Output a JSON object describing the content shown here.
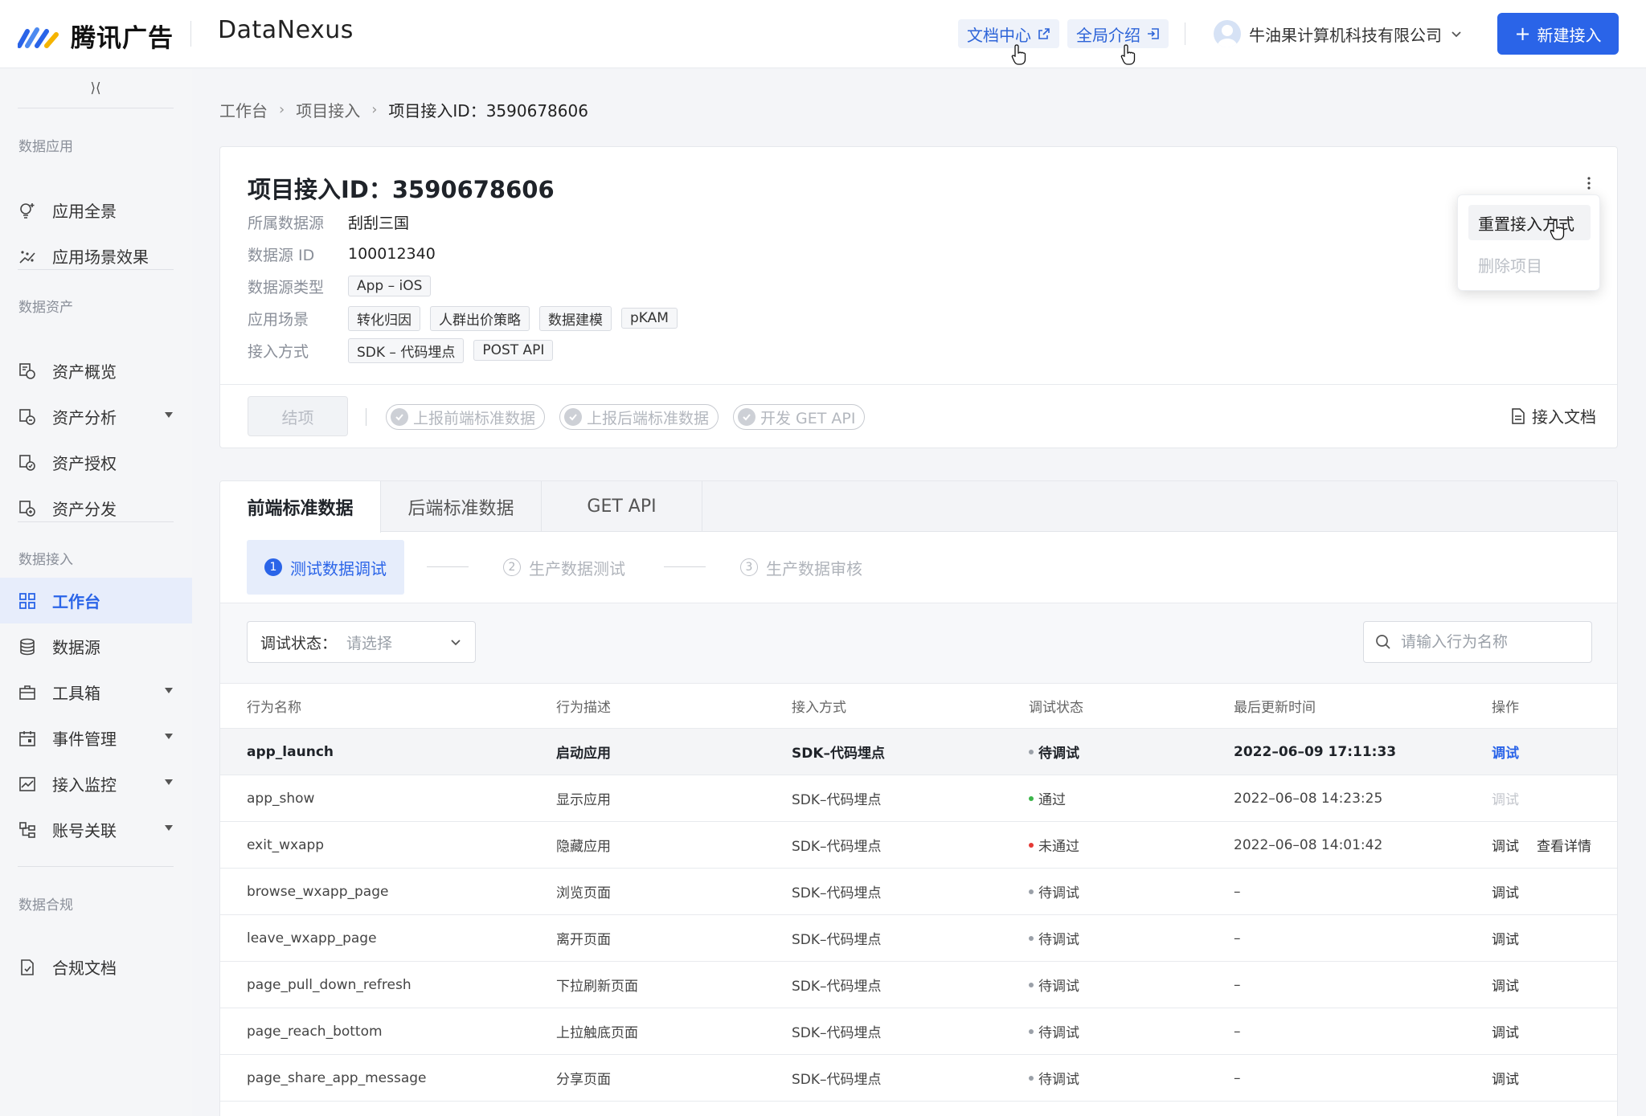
{
  "header": {
    "logo_text": "腾讯广告",
    "product": "DataNexus",
    "doc_center": "文档中心",
    "global_intro": "全局介绍",
    "account": "牛油果计算机科技有限公司",
    "new_button": "新建接入"
  },
  "sidebar": {
    "groups": [
      "数据应用",
      "数据资产",
      "数据接入",
      "数据合规"
    ],
    "items": [
      {
        "label": "应用全景",
        "icon": "bulb-icon"
      },
      {
        "label": "应用场景效果",
        "icon": "scatter-icon"
      },
      {
        "label": "资产概览",
        "icon": "asset-icon"
      },
      {
        "label": "资产分析",
        "icon": "asset-analysis-icon",
        "expandable": true
      },
      {
        "label": "资产授权",
        "icon": "asset-auth-icon"
      },
      {
        "label": "资产分发",
        "icon": "asset-dist-icon"
      },
      {
        "label": "工作台",
        "icon": "grid-icon",
        "active": true
      },
      {
        "label": "数据源",
        "icon": "database-icon"
      },
      {
        "label": "工具箱",
        "icon": "toolbox-icon",
        "expandable": true
      },
      {
        "label": "事件管理",
        "icon": "calendar-icon",
        "expandable": true
      },
      {
        "label": "接入监控",
        "icon": "monitor-icon",
        "expandable": true
      },
      {
        "label": "账号关联",
        "icon": "link-tree-icon",
        "expandable": true
      },
      {
        "label": "合规文档",
        "icon": "compliance-doc-icon"
      }
    ]
  },
  "breadcrumb": [
    "工作台",
    "项目接入",
    "项目接入ID：3590678606"
  ],
  "project": {
    "title": "项目接入ID：3590678606",
    "fields": {
      "source_label": "所属数据源",
      "source_value": "刮刮三国",
      "source_id_label": "数据源 ID",
      "source_id_value": "100012340",
      "type_label": "数据源类型",
      "type_tag": "App – iOS",
      "scene_label": "应用场景",
      "scene_tags": [
        "转化归因",
        "人群出价策略",
        "数据建模",
        "pKAM"
      ],
      "method_label": "接入方式",
      "method_tags": [
        "SDK – 代码埋点",
        "POST API"
      ]
    },
    "finish_button": "结项",
    "progress_chips": [
      "上报前端标准数据",
      "上报后端标准数据",
      "开发 GET API"
    ],
    "doc_link": "接入文档"
  },
  "menu": {
    "reset": "重置接入方式",
    "delete": "删除项目"
  },
  "tabs": [
    "前端标准数据",
    "后端标准数据",
    "GET API"
  ],
  "steps": [
    {
      "num": "1",
      "label": "测试数据调试",
      "active": true
    },
    {
      "num": "2",
      "label": "生产数据测试",
      "active": false
    },
    {
      "num": "3",
      "label": "生产数据审核",
      "active": false
    }
  ],
  "filter": {
    "status_label": "调试状态：",
    "status_placeholder": "请选择",
    "search_placeholder": "请输入行为名称"
  },
  "colors": {
    "accent": "#2a64e8",
    "pending": "#9aa0a8",
    "pass": "#3bb54a",
    "fail": "#e53935"
  },
  "table": {
    "headers": [
      "行为名称",
      "行为描述",
      "接入方式",
      "调试状态",
      "最后更新时间",
      "操作"
    ],
    "rows": [
      {
        "name": "app_launch",
        "desc": "启动应用",
        "method": "SDK–代码埋点",
        "status": "待调试",
        "status_kind": "pending",
        "time": "2022–06–09 17:11:33",
        "op1": "调试",
        "op1_kind": "link",
        "op2": "",
        "highlight": true
      },
      {
        "name": "app_show",
        "desc": "显示应用",
        "method": "SDK–代码埋点",
        "status": "通过",
        "status_kind": "pass",
        "time": "2022–06–08 14:23:25",
        "op1": "调试",
        "op1_kind": "dis",
        "op2": ""
      },
      {
        "name": "exit_wxapp",
        "desc": "隐藏应用",
        "method": "SDK–代码埋点",
        "status": "未通过",
        "status_kind": "fail",
        "time": "2022–06–08 14:01:42",
        "op1": "调试",
        "op1_kind": "normal",
        "op2": "查看详情"
      },
      {
        "name": "browse_wxapp_page",
        "desc": "浏览页面",
        "method": "SDK–代码埋点",
        "status": "待调试",
        "status_kind": "pending",
        "time": "–",
        "op1": "调试",
        "op1_kind": "normal",
        "op2": ""
      },
      {
        "name": "leave_wxapp_page",
        "desc": "离开页面",
        "method": "SDK–代码埋点",
        "status": "待调试",
        "status_kind": "pending",
        "time": "–",
        "op1": "调试",
        "op1_kind": "normal",
        "op2": ""
      },
      {
        "name": "page_pull_down_refresh",
        "desc": "下拉刷新页面",
        "method": "SDK–代码埋点",
        "status": "待调试",
        "status_kind": "pending",
        "time": "–",
        "op1": "调试",
        "op1_kind": "normal",
        "op2": ""
      },
      {
        "name": "page_reach_bottom",
        "desc": "上拉触底页面",
        "method": "SDK–代码埋点",
        "status": "待调试",
        "status_kind": "pending",
        "time": "–",
        "op1": "调试",
        "op1_kind": "normal",
        "op2": ""
      },
      {
        "name": "page_share_app_message",
        "desc": "分享页面",
        "method": "SDK–代码埋点",
        "status": "待调试",
        "status_kind": "pending",
        "time": "–",
        "op1": "调试",
        "op1_kind": "normal",
        "op2": ""
      }
    ]
  }
}
